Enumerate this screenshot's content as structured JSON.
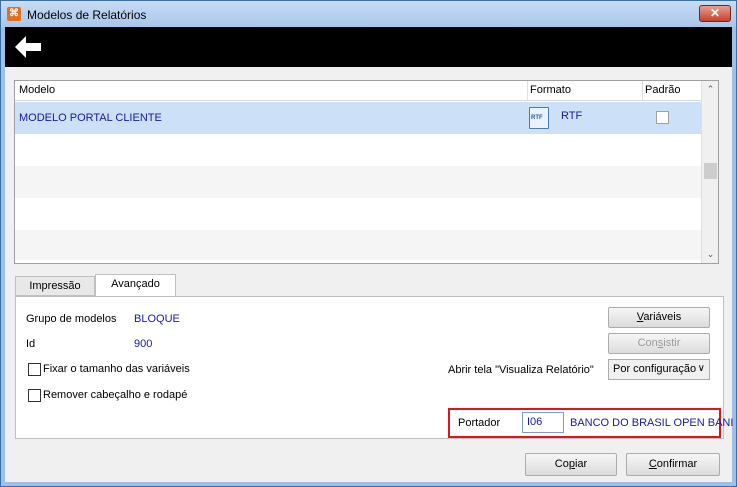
{
  "window": {
    "title": "Modelos de Relatórios",
    "app_icon": "app-icon",
    "close_glyph": "✕"
  },
  "toolbar": {
    "back_icon": "back-arrow-icon"
  },
  "grid": {
    "columns": [
      "Modelo",
      "Formato",
      "Padrão"
    ],
    "rows": [
      {
        "modelo": "MODELO PORTAL CLIENTE",
        "format_icon_text": "RTF",
        "formato": "RTF",
        "padrao": false
      }
    ]
  },
  "tabs": [
    {
      "label": "Impressão",
      "active": false
    },
    {
      "label": "Avançado",
      "active": true
    }
  ],
  "advanced": {
    "grupo_label": "Grupo de modelos",
    "grupo_value": "BLOQUE",
    "id_label": "Id",
    "id_value": "900",
    "fixar_label": "Fixar o tamanho das variáveis",
    "fixar_checked": false,
    "remover_label": "Remover cabeçalho e rodapé",
    "remover_checked": false,
    "variaveis_button": {
      "mnemonic": "V",
      "rest": "ariáveis"
    },
    "consistir_button": {
      "before": "Con",
      "mnemonic": "s",
      "after": "istir"
    },
    "abrir_label": "Abrir tela \"Visualiza Relatório\"",
    "abrir_value": "Por configuração",
    "portador_label": "Portador",
    "portador_value": "I06",
    "portador_name": "BANCO DO BRASIL OPEN BANI"
  },
  "footer": {
    "copiar_button": {
      "before": "Co",
      "mnemonic": "p",
      "after": "iar"
    },
    "confirmar_button": {
      "mnemonic": "C",
      "rest": "onfirmar"
    }
  },
  "colors": {
    "highlight_border": "#e0141e",
    "value_text": "#1a1a9c",
    "selected_row": "#cce0f7"
  }
}
